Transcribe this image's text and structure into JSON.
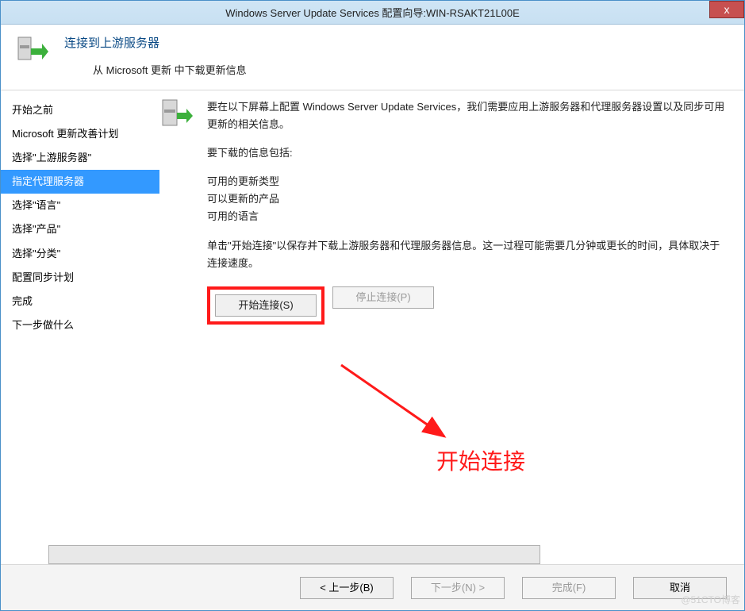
{
  "window": {
    "title": "Windows Server Update Services 配置向导:WIN-RSAKT21L00E",
    "close": "x"
  },
  "header": {
    "title": "连接到上游服务器",
    "subtitle": "从 Microsoft 更新 中下载更新信息"
  },
  "sidebar": {
    "items": [
      {
        "label": "开始之前",
        "selected": false
      },
      {
        "label": "Microsoft 更新改善计划",
        "selected": false
      },
      {
        "label": "选择\"上游服务器\"",
        "selected": false
      },
      {
        "label": "指定代理服务器",
        "selected": true
      },
      {
        "label": "选择\"语言\"",
        "selected": false
      },
      {
        "label": "选择\"产品\"",
        "selected": false
      },
      {
        "label": "选择\"分类\"",
        "selected": false
      },
      {
        "label": "配置同步计划",
        "selected": false
      },
      {
        "label": "完成",
        "selected": false
      },
      {
        "label": "下一步做什么",
        "selected": false
      }
    ]
  },
  "content": {
    "para1": "要在以下屏幕上配置 Windows Server Update Services，我们需要应用上游服务器和代理服务器设置以及同步可用更新的相关信息。",
    "para2": "要下载的信息包括:",
    "list1": "可用的更新类型",
    "list2": "可以更新的产品",
    "list3": "可用的语言",
    "para3": "单击\"开始连接\"以保存并下载上游服务器和代理服务器信息。这一过程可能需要几分钟或更长的时间，具体取决于连接速度。",
    "start_button": "开始连接(S)",
    "stop_button": "停止连接(P)"
  },
  "footer": {
    "back": "< 上一步(B)",
    "next": "下一步(N) >",
    "finish": "完成(F)",
    "cancel": "取消"
  },
  "annotation": {
    "label": "开始连接"
  },
  "watermark": "@51CTO博客"
}
